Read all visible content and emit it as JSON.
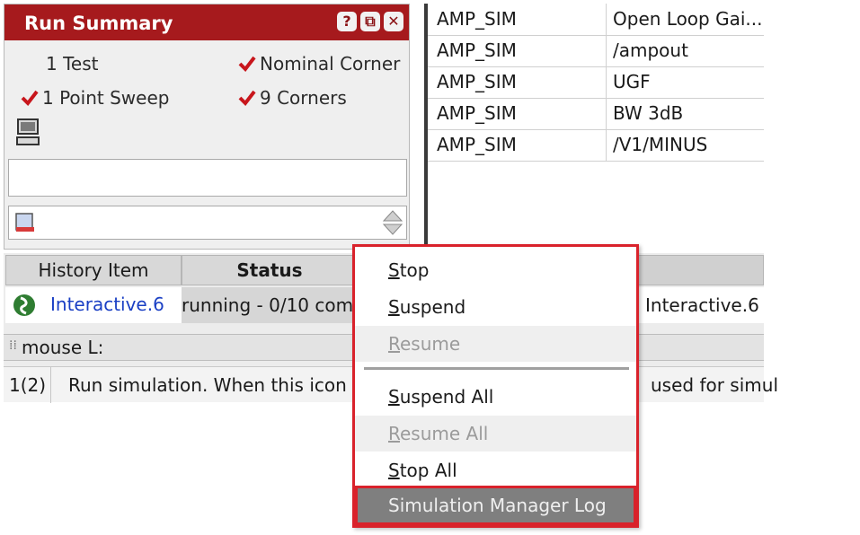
{
  "run_summary": {
    "title": "Run Summary",
    "tests": "1 Test",
    "nominal_corner": "Nominal Corner",
    "point_sweep": "1 Point Sweep",
    "corners": "9 Corners"
  },
  "results_table": {
    "rows": [
      {
        "test": "AMP_SIM",
        "output": "Open Loop Gai..."
      },
      {
        "test": "AMP_SIM",
        "output": "/ampout"
      },
      {
        "test": "AMP_SIM",
        "output": "UGF"
      },
      {
        "test": "AMP_SIM",
        "output": "BW 3dB"
      },
      {
        "test": "AMP_SIM",
        "output": "/V1/MINUS"
      }
    ]
  },
  "history": {
    "col_history_item": "History Item",
    "col_status": "Status",
    "item_name": "Interactive.6",
    "item_status": "running - 0/10 com",
    "item_name_right": "Interactive.6"
  },
  "mouse_bar": {
    "label": "mouse L:"
  },
  "status_bar": {
    "index": "1(2)",
    "message_left": "Run simulation. When this icon",
    "message_right": "used for simul"
  },
  "context_menu": {
    "items": [
      {
        "key": "S",
        "rest": "top"
      },
      {
        "key": "S",
        "rest": "uspend"
      },
      {
        "key": "R",
        "rest": "esume"
      },
      {
        "key": "S",
        "rest": "uspend All"
      },
      {
        "key": "R",
        "rest": "esume All"
      },
      {
        "key": "S",
        "rest": "top All"
      }
    ],
    "log_label": "Simulation Manager Log"
  },
  "colors": {
    "title_bar": "#a61a1d",
    "highlight": "#d9222b",
    "link": "#1a3fc4"
  }
}
